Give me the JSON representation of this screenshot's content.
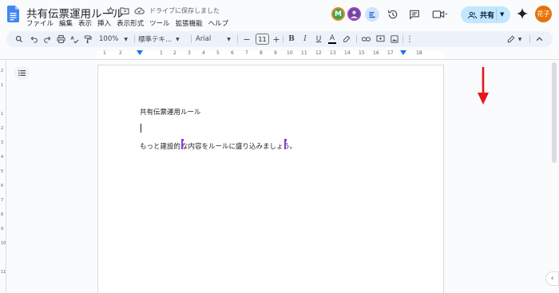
{
  "app": {
    "doc_title": "共有伝票運用ルール",
    "save_status": "ドライブに保存しました",
    "user_initials": "花子"
  },
  "menu": [
    "ファイル",
    "編集",
    "表示",
    "挿入",
    "表示形式",
    "ツール",
    "拡張機能",
    "ヘルプ"
  ],
  "header": {
    "collaborator_m": "M",
    "share_label": "共有"
  },
  "toolbar": {
    "zoom": "100%",
    "style": "標準テキ...",
    "font": "Arial",
    "font_size": "11"
  },
  "ruler": {
    "numbers": [
      "1",
      "2",
      "1",
      "2",
      "3",
      "4",
      "5",
      "6",
      "7",
      "8",
      "9",
      "10",
      "11",
      "12",
      "13",
      "14",
      "15",
      "16",
      "17",
      "18"
    ]
  },
  "vruler": {
    "numbers": [
      "2",
      "1",
      "1",
      "2",
      "3",
      "4",
      "5",
      "6",
      "7",
      "8",
      "9",
      "10",
      "11"
    ]
  },
  "document": {
    "line1": "共有伝票運用ルール",
    "line3_a": "もっと建設的",
    "line3_b": "な内容をルールに盛り込みましょう",
    "line3_c": "。"
  },
  "colors": {
    "accent": "#c2e7ff",
    "collaborator_cursor": "#9334e6",
    "annotation_arrow": "#e8141a"
  }
}
